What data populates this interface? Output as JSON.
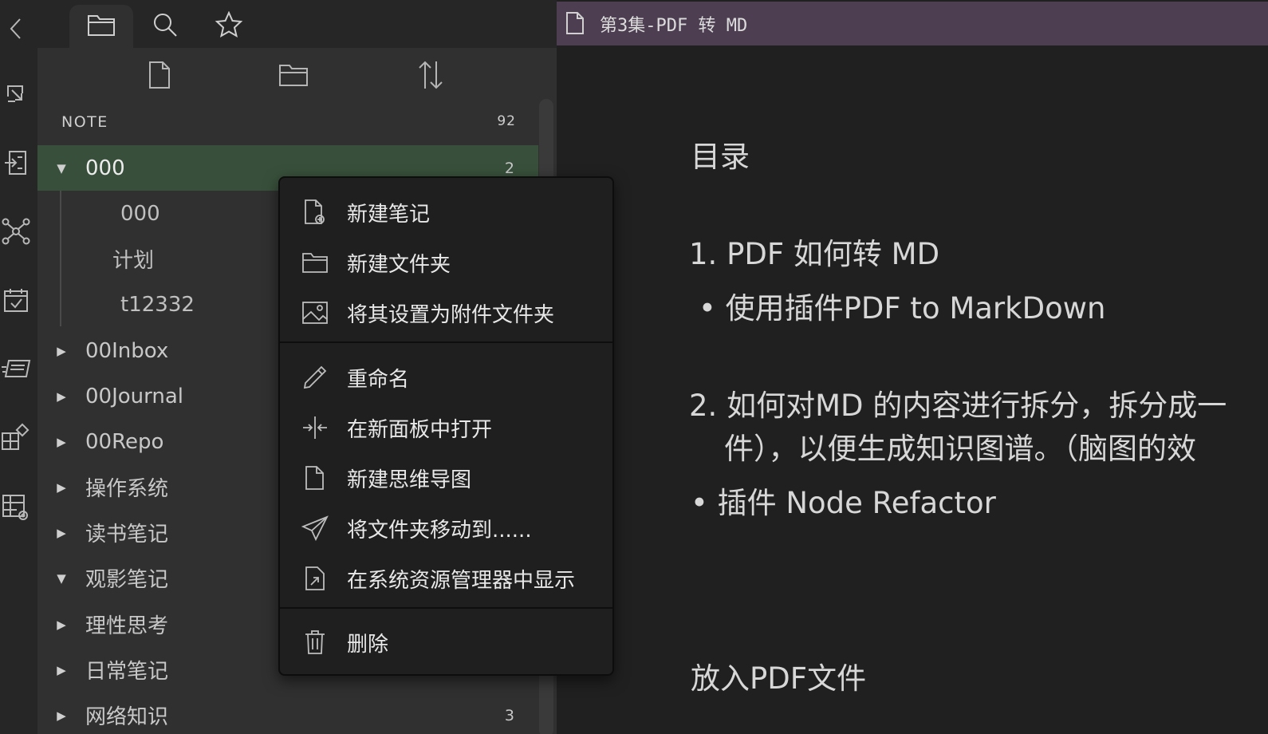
{
  "ribbon": {
    "items": [
      {
        "icon": "back-arrow-icon"
      },
      {
        "icon": "open-quick-switcher-icon"
      },
      {
        "icon": "command-palette-icon"
      },
      {
        "icon": "graph-view-icon"
      },
      {
        "icon": "daily-notes-icon"
      },
      {
        "icon": "slides-icon"
      },
      {
        "icon": "plugins-icon"
      },
      {
        "icon": "table-settings-icon"
      }
    ]
  },
  "sidebar": {
    "tabs": [
      {
        "icon": "folder-icon",
        "active": true
      },
      {
        "icon": "search-icon",
        "active": false
      },
      {
        "icon": "star-icon",
        "active": false
      }
    ],
    "actions": [
      {
        "icon": "new-note-icon"
      },
      {
        "icon": "new-folder-icon"
      },
      {
        "icon": "sort-icon"
      }
    ],
    "vault_name": "NOTE",
    "vault_count": "92",
    "tree": [
      {
        "label": "000",
        "expanded": true,
        "count": "2",
        "selected": true
      },
      {
        "label": "000",
        "child": true
      },
      {
        "label": "计划",
        "child": true
      },
      {
        "label": "t12332",
        "child": true
      },
      {
        "label": "00Inbox",
        "expanded": false
      },
      {
        "label": "00Journal",
        "expanded": false
      },
      {
        "label": "00Repo",
        "expanded": false
      },
      {
        "label": "操作系统",
        "expanded": false
      },
      {
        "label": "读书笔记",
        "expanded": false
      },
      {
        "label": "观影笔记",
        "expanded": true
      },
      {
        "label": "理性思考",
        "expanded": false
      },
      {
        "label": "日常笔记",
        "expanded": false
      },
      {
        "label": "网络知识",
        "expanded": false,
        "count": "3"
      }
    ]
  },
  "editor": {
    "tab_title": "第3集-PDF 转 MD",
    "doc": {
      "heading": "目录",
      "item1": "1. PDF 如何转 MD",
      "bullet1": "• 使用插件PDF to MarkDown",
      "item2_line1": "2. 如何对MD 的内容进行拆分，拆分成一",
      "item2_line2": "件），以便生成知识图谱。（脑图的效",
      "bullet2": "• 插件 Node Refactor",
      "heading2": "放入PDF文件"
    }
  },
  "context_menu": {
    "items": [
      {
        "label": "新建笔记",
        "icon": "new-note-icon"
      },
      {
        "label": "新建文件夹",
        "icon": "folder-icon"
      },
      {
        "label": "将其设置为附件文件夹",
        "icon": "image-icon"
      },
      {
        "label": "重命名",
        "icon": "pencil-icon"
      },
      {
        "label": "在新面板中打开",
        "icon": "split-pane-icon"
      },
      {
        "label": "新建思维导图",
        "icon": "document-icon"
      },
      {
        "label": "将文件夹移动到......",
        "icon": "send-icon"
      },
      {
        "label": "在系统资源管理器中显示",
        "icon": "reveal-in-explorer-icon"
      },
      {
        "label": "删除",
        "icon": "trash-icon"
      }
    ]
  }
}
